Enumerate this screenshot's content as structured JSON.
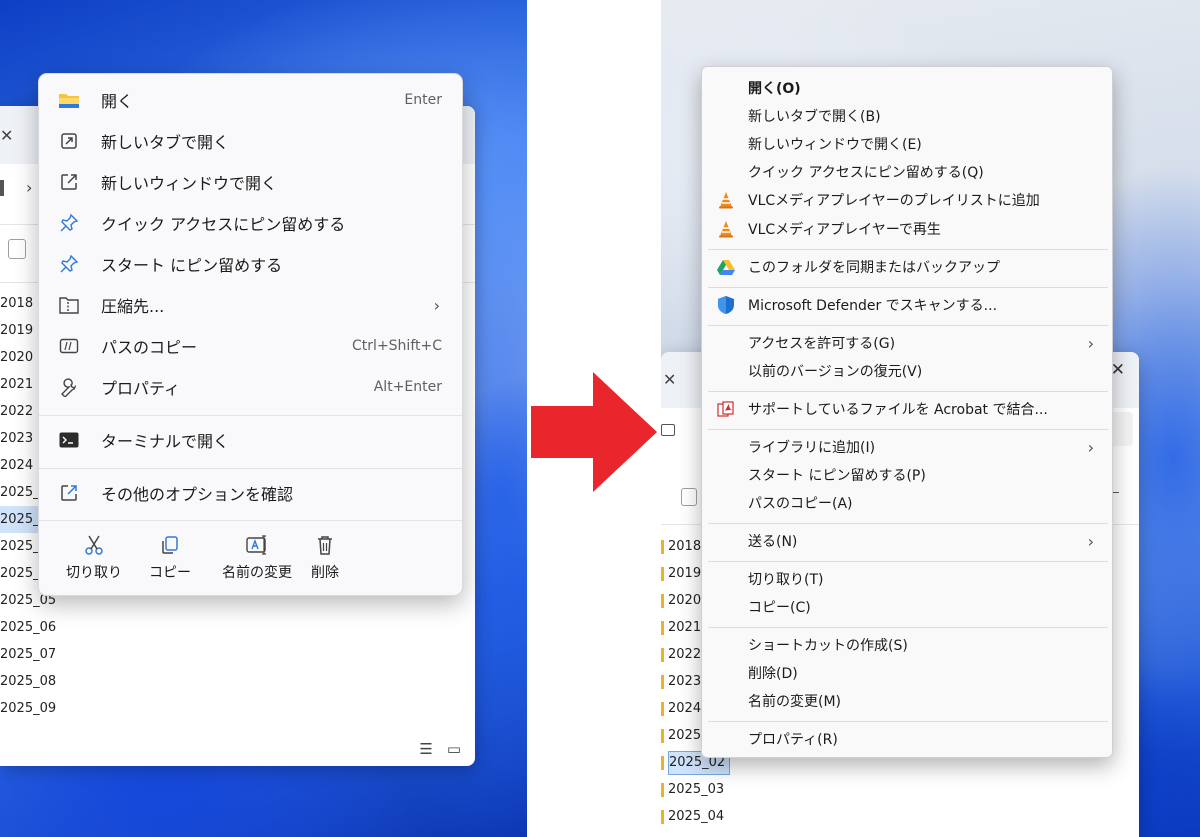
{
  "left_menu": {
    "items": [
      {
        "label": "開く",
        "shortcut": "Enter",
        "icon": "folder-icon"
      },
      {
        "label": "新しいタブで開く",
        "shortcut": "",
        "icon": "new-tab-icon"
      },
      {
        "label": "新しいウィンドウで開く",
        "shortcut": "",
        "icon": "new-window-icon"
      },
      {
        "label": "クイック アクセスにピン留めする",
        "shortcut": "",
        "icon": "pin-icon"
      },
      {
        "label": "スタート にピン留めする",
        "shortcut": "",
        "icon": "pin-icon"
      },
      {
        "label": "圧縮先...",
        "shortcut": "",
        "icon": "zip-folder-icon"
      },
      {
        "label": "パスのコピー",
        "shortcut": "Ctrl+Shift+C",
        "icon": "copy-path-icon"
      },
      {
        "label": "プロパティ",
        "shortcut": "Alt+Enter",
        "icon": "wrench-icon"
      },
      {
        "label": "ターミナルで開く",
        "shortcut": "",
        "icon": "terminal-icon"
      },
      {
        "label": "その他のオプションを確認",
        "shortcut": "",
        "icon": "more-options-icon"
      }
    ],
    "actions": [
      {
        "label": "切り取り",
        "icon": "scissors-icon"
      },
      {
        "label": "コピー",
        "icon": "copy-icon"
      },
      {
        "label": "名前の変更",
        "icon": "rename-icon"
      },
      {
        "label": "削除",
        "icon": "trash-icon"
      }
    ]
  },
  "left_window": {
    "files": [
      "2018",
      "2019",
      "2020",
      "2021",
      "2022",
      "2023",
      "2024",
      "2025_0",
      "2025_0",
      "2025_0",
      "2025_0",
      "2025_05",
      "2025_06",
      "2025_07",
      "2025_08",
      "2025_09"
    ],
    "selected_index": 8
  },
  "right_menu": {
    "items": [
      {
        "label": "開く(O)",
        "icon": ""
      },
      {
        "label": "新しいタブで開く(B)",
        "icon": ""
      },
      {
        "label": "新しいウィンドウで開く(E)",
        "icon": ""
      },
      {
        "label": "クイック アクセスにピン留めする(Q)",
        "icon": ""
      },
      {
        "label": "VLCメディアプレイヤーのプレイリストに追加",
        "icon": "vlc-cone-icon"
      },
      {
        "label": "VLCメディアプレイヤーで再生",
        "icon": "vlc-cone-icon"
      },
      {
        "label": "このフォルダを同期またはバックアップ",
        "icon": "google-drive-icon"
      },
      {
        "label": "Microsoft Defender でスキャンする...",
        "icon": "defender-shield-icon"
      },
      {
        "label": "アクセスを許可する(G)",
        "icon": ""
      },
      {
        "label": "以前のバージョンの復元(V)",
        "icon": ""
      },
      {
        "label": "サポートしているファイルを Acrobat で結合...",
        "icon": "acrobat-icon"
      },
      {
        "label": "ライブラリに追加(I)",
        "icon": ""
      },
      {
        "label": "スタート にピン留めする(P)",
        "icon": ""
      },
      {
        "label": "パスのコピー(A)",
        "icon": ""
      },
      {
        "label": "送る(N)",
        "icon": ""
      },
      {
        "label": "切り取り(T)",
        "icon": ""
      },
      {
        "label": "コピー(C)",
        "icon": ""
      },
      {
        "label": "ショートカットの作成(S)",
        "icon": ""
      },
      {
        "label": "削除(D)",
        "icon": ""
      },
      {
        "label": "名前の変更(M)",
        "icon": ""
      },
      {
        "label": "プロパティ(R)",
        "icon": ""
      }
    ]
  },
  "right_window": {
    "files": [
      "2018",
      "2019",
      "2020",
      "2021",
      "2022",
      "2023",
      "2024",
      "2025_",
      "2025_02",
      "2025_03",
      "2025_04"
    ],
    "selected_index": 8
  },
  "colors": {
    "arrow": "#e8262b",
    "accent": "#1e63d8",
    "folder": "#e8b22c"
  }
}
